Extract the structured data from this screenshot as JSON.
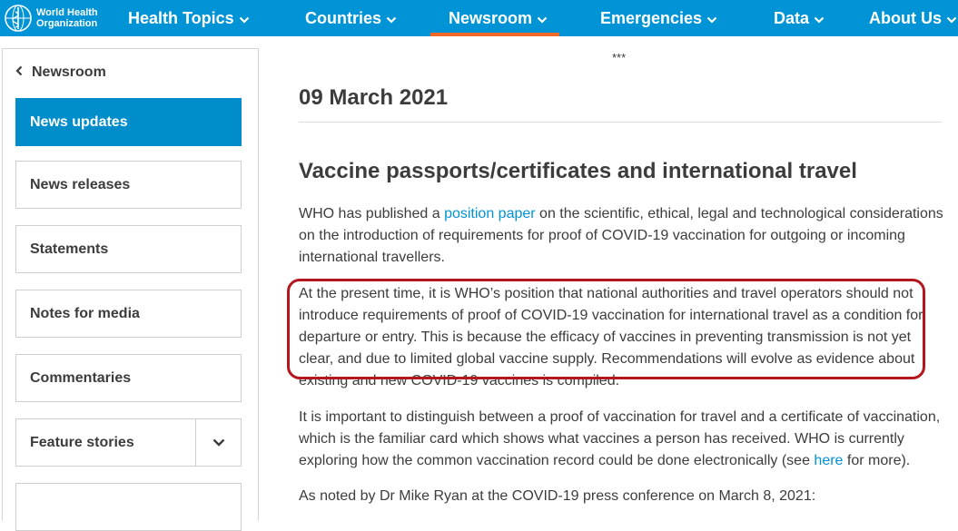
{
  "logo": {
    "line1": "World Health",
    "line2": "Organization",
    "icon": "who-emblem-icon"
  },
  "nav": {
    "items": [
      {
        "label": "Health Topics",
        "active": false
      },
      {
        "label": "Countries",
        "active": false
      },
      {
        "label": "Newsroom",
        "active": true
      },
      {
        "label": "Emergencies",
        "active": false
      },
      {
        "label": "Data",
        "active": false
      },
      {
        "label": "About Us",
        "active": false
      }
    ],
    "active_color": "#f26829",
    "bar_color": "#0093d5"
  },
  "sidebar": {
    "back_label": "Newsroom",
    "items": [
      {
        "label": "News updates",
        "active": true
      },
      {
        "label": "News releases",
        "active": false
      },
      {
        "label": "Statements",
        "active": false
      },
      {
        "label": "Notes for media",
        "active": false
      },
      {
        "label": "Commentaries",
        "active": false
      },
      {
        "label": "Feature stories",
        "active": false,
        "expandable": true
      }
    ],
    "active_color": "#008dc9"
  },
  "main": {
    "separator": "***",
    "date": "09 March 2021",
    "headline": "Vaccine passports/certificates and international travel",
    "p1": {
      "before": "WHO has published a ",
      "link": "position paper",
      "after": " on the scientific, ethical, legal and technological considerations on the introduction of requirements for proof of COVID-19 vaccination for outgoing or incoming international travellers."
    },
    "p2": "At the present time, it is WHO’s position that national authorities and travel operators should not introduce requirements of proof of COVID-19 vaccination for international travel as a condition for departure or entry. This is because the efficacy of vaccines in preventing transmission is not yet clear, and due to limited global vaccine supply. Recommendations will evolve as evidence about existing and new COVID-19 vaccines is compiled.",
    "p3": {
      "before": "It is important to distinguish between a proof of vaccination for travel and a certificate of vaccination, which is the familiar card which shows what vaccines a person has received. WHO is currently exploring how the common vaccination record could be done electronically (see ",
      "link": "here",
      "after": " for more)."
    },
    "p4": "As noted by Dr Mike Ryan at the COVID-19 press conference on March 8, 2021:",
    "highlight_color": "#b3161c"
  }
}
